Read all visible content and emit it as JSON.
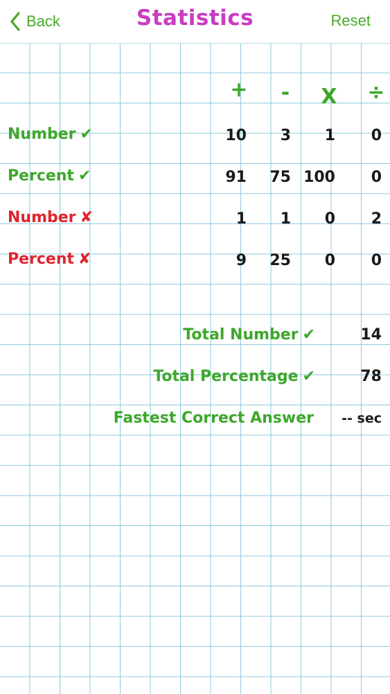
{
  "nav": {
    "back_label": "Back",
    "title": "Statistics",
    "reset_label": "Reset"
  },
  "colors": {
    "accent_green": "#3ea72b",
    "title_magenta": "#c93cc2",
    "error_red": "#e0242f",
    "grid_line": "#8cc9dc"
  },
  "operations": [
    "+",
    "-",
    "X",
    "÷"
  ],
  "rows": [
    {
      "label": "Number",
      "mark": "✔",
      "values": [
        "10",
        "3",
        "1",
        "0"
      ]
    },
    {
      "label": "Percent",
      "mark": "✔",
      "values": [
        "91",
        "75",
        "100",
        "0"
      ]
    },
    {
      "label": "Number",
      "mark": "✘",
      "values": [
        "1",
        "1",
        "0",
        "2"
      ]
    },
    {
      "label": "Percent",
      "mark": "✘",
      "values": [
        "9",
        "25",
        "0",
        "0"
      ]
    }
  ],
  "summary": {
    "total_number_label": "Total Number",
    "total_number_mark": "✔",
    "total_number_value": "14",
    "total_percentage_label": "Total Percentage",
    "total_percentage_mark": "✔",
    "total_percentage_value": "78",
    "fastest_label": "Fastest Correct Answer",
    "fastest_value": "-- sec"
  }
}
